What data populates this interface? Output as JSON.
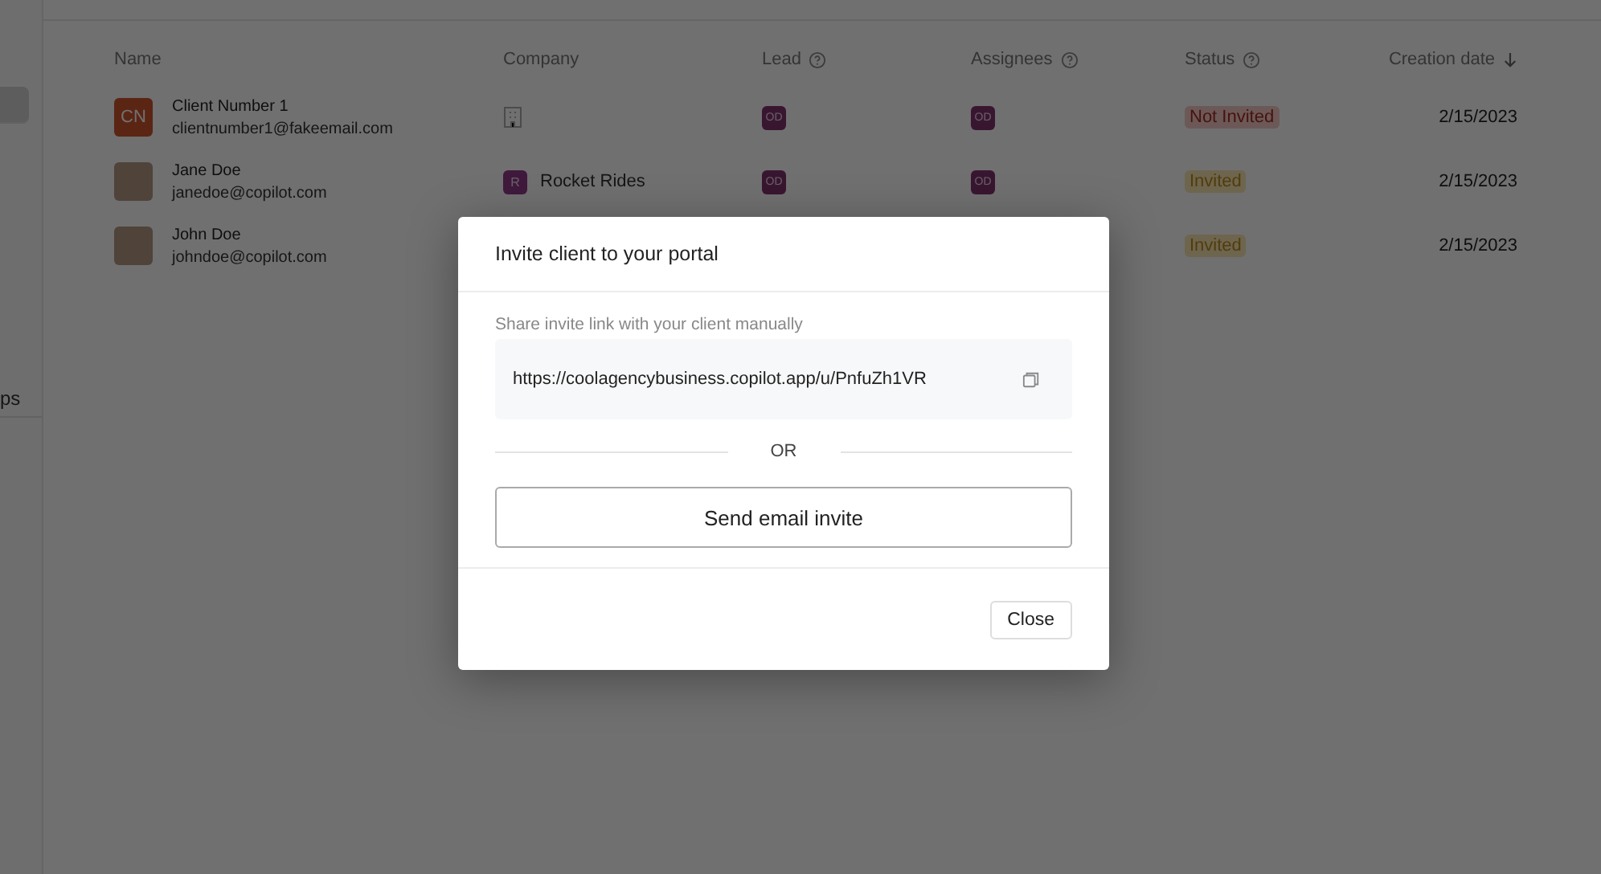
{
  "sidebar": {
    "items": [
      {
        "selected": true
      },
      {
        "label": "ps",
        "selected": false
      }
    ]
  },
  "table": {
    "columns": [
      {
        "label": "Name",
        "help": false,
        "sorted": false
      },
      {
        "label": "Company",
        "help": false,
        "sorted": false
      },
      {
        "label": "Lead",
        "help": true,
        "sorted": false
      },
      {
        "label": "Assignees",
        "help": true,
        "sorted": false
      },
      {
        "label": "Status",
        "help": true,
        "sorted": false
      },
      {
        "label": "Creation date",
        "help": false,
        "sorted": true
      }
    ],
    "rows": [
      {
        "avatar": {
          "kind": "initials",
          "text": "CN"
        },
        "name": "Client Number 1",
        "email": "clientnumber1@fakeemail.com",
        "company": {
          "kind": "empty"
        },
        "lead": "OD",
        "assignee": "OD",
        "status": {
          "label": "Not Invited",
          "kind": "not_invited"
        },
        "date": "2/15/2023"
      },
      {
        "avatar": {
          "kind": "photo"
        },
        "name": "Jane Doe",
        "email": "janedoe@copilot.com",
        "company": {
          "kind": "badge",
          "initial": "R",
          "name": "Rocket Rides"
        },
        "lead": "OD",
        "assignee": "OD",
        "status": {
          "label": "Invited",
          "kind": "invited"
        },
        "date": "2/15/2023"
      },
      {
        "avatar": {
          "kind": "photo"
        },
        "name": "John Doe",
        "email": "johndoe@copilot.com",
        "company": {
          "kind": "hidden"
        },
        "lead": "",
        "assignee": "",
        "status": {
          "label": "Invited",
          "kind": "invited"
        },
        "date": "2/15/2023"
      }
    ]
  },
  "dialog": {
    "title": "Invite client to your portal",
    "share_label": "Share invite link with your client manually",
    "link": "https://coolagencybusiness.copilot.app/u/PnfuZh1VR",
    "divider_text": "OR",
    "email_button": "Send email invite",
    "close_button": "Close"
  }
}
